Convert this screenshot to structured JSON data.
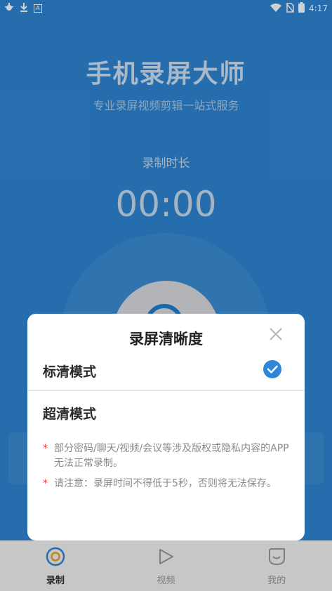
{
  "status_bar": {
    "left_icons": [
      "bug-icon",
      "download-icon",
      "a-icon"
    ],
    "right_icons": [
      "wifi-icon",
      "no-sim-icon",
      "battery-icon"
    ],
    "time": "4:17"
  },
  "hero": {
    "title": "手机录屏大师",
    "subtitle": "专业录屏视频剪辑一站式服务",
    "duration_label": "录制时长",
    "timer": "00:00"
  },
  "dialog": {
    "title": "录屏清晰度",
    "options": [
      {
        "label": "标清模式",
        "selected": true
      },
      {
        "label": "超清模式",
        "selected": false
      }
    ],
    "notes": [
      "部分密码/聊天/视频/会议等涉及版权或隐私内容的APP无法正常录制。",
      "请注意：录屏时间不得低于5秒，否则将无法保存。"
    ],
    "note_marker": "*"
  },
  "tabs": [
    {
      "label": "录制",
      "icon": "record-icon",
      "active": true
    },
    {
      "label": "视频",
      "icon": "video-icon",
      "active": false
    },
    {
      "label": "我的",
      "icon": "profile-icon",
      "active": false
    }
  ],
  "colors": {
    "primary": "#2d86d6",
    "accent_orange": "#f0a020",
    "star_red": "#e23b3b"
  }
}
